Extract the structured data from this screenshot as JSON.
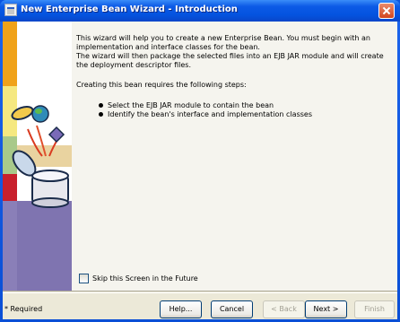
{
  "window": {
    "title": "New Enterprise Bean Wizard - Introduction"
  },
  "content": {
    "intro_paragraph": "This wizard will help you to create a new Enterprise Bean. You must begin with an implementation and interface classes for the bean.\nThe wizard will then package the selected files into an EJB JAR module and will create the deployment descriptor files.",
    "steps_heading": "Creating this bean requires the following steps:",
    "steps": [
      "Select the EJB JAR module to contain the bean",
      "Identify the bean's interface and implementation classes"
    ],
    "skip_checkbox_label": "Skip this Screen in the Future",
    "skip_checked": false
  },
  "footer": {
    "required_note": "* Required",
    "buttons": {
      "help": "Help...",
      "cancel": "Cancel",
      "back": "< Back",
      "next": "Next >",
      "finish": "Finish"
    }
  },
  "colors": {
    "titlebar": "#0453df",
    "sidebar_orange": "#f0a21a",
    "sidebar_yellow": "#f5e880",
    "sidebar_green": "#a8c98a",
    "sidebar_red": "#c8202c",
    "sidebar_purple": "#8a7fb8",
    "panel_background": "#ece9d8"
  },
  "icons": [
    "close-icon",
    "window-icon",
    "wizard-illustration"
  ]
}
